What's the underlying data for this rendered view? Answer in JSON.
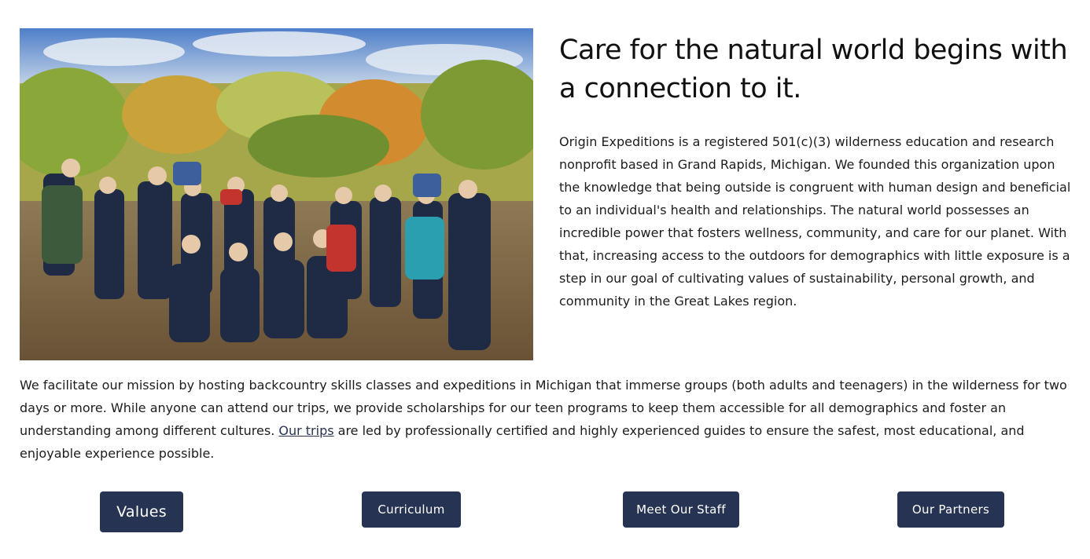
{
  "hero": {
    "image_subject": "group-of-hikers-with-backpacks-in-autumn-forest",
    "headline": "Care for the natural world begins with a connection to it.",
    "intro": "Origin Expeditions is a registered 501(c)(3) wilderness education and research nonprofit based in Grand Rapids, Michigan. We founded this organization upon the knowledge that being outside is congruent with human design and beneficial to an individual's health and relationships. The natural world possesses an incredible power that fosters wellness, community, and care for our planet. With that, increasing access to the outdoors for demographics with little exposure is a step in our goal of cultivating values of sustainability, personal growth, and community in the Great Lakes region."
  },
  "mission": {
    "before_link": "We facilitate our mission by hosting backcountry skills classes and expeditions in Michigan that immerse groups (both adults and teenagers) in the wilderness for two days or more. While anyone can attend our trips, we provide scholarships for our teen programs to keep them accessible for all demographics and foster an understanding among different cultures. ",
    "link_text": "Our trips",
    "after_link": " are led by professionally certified and highly experienced guides to ensure the safest, most educational, and enjoyable experience possible."
  },
  "buttons": {
    "values": "Values",
    "curriculum": "Curriculum",
    "staff": "Meet Our Staff",
    "partners": "Our Partners"
  },
  "colors": {
    "button_bg": "#263352",
    "link": "#273350",
    "text": "#1c1c1c"
  }
}
